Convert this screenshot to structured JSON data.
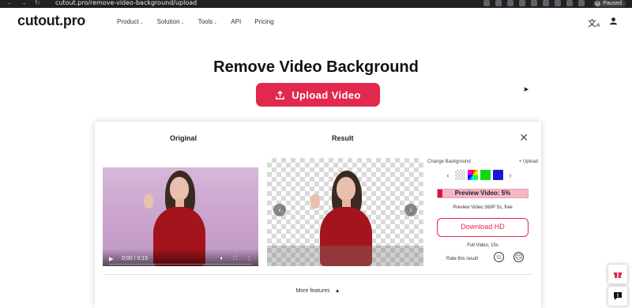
{
  "browser": {
    "url": "cutout.pro/remove-video-background/upload",
    "profile_initial": "F",
    "profile_status": "Paused"
  },
  "header": {
    "logo": "cutout.pro",
    "menu": [
      {
        "label": "Product",
        "has_caret": true
      },
      {
        "label": "Solution",
        "has_caret": true
      },
      {
        "label": "Tools",
        "has_caret": true
      },
      {
        "label": "API",
        "has_caret": false
      },
      {
        "label": "Pricing",
        "has_caret": false
      }
    ]
  },
  "hero": {
    "title": "Remove Video Background",
    "upload_label": "Upload Video"
  },
  "panel": {
    "original_title": "Original",
    "result_title": "Result",
    "video_time": "0:00 / 0:15",
    "change_background": "Change Background",
    "upload_link": "+ Upload",
    "swatches": [
      {
        "name": "transparent",
        "color": "transparent"
      },
      {
        "name": "rainbow",
        "color": "rainbow"
      },
      {
        "name": "green",
        "color": "#11d911"
      },
      {
        "name": "blue",
        "color": "#1a1ad6"
      }
    ],
    "preview_label": "Preview Video: 5%",
    "preview_progress": 0.05,
    "preview_sub": "Preview Video 360P 5s, free",
    "download_label": "Download HD",
    "full_sub": "Full Video, 15s",
    "rate_label": "Rate this result",
    "more_features": "More features"
  },
  "colors": {
    "brand": "#e2284d",
    "progress_fill": "#d6163e",
    "progress_bg": "#f7b6c6"
  },
  "icons": {
    "upload": "upload-icon",
    "close": "close-icon",
    "translate": "translate-icon",
    "user": "user-icon",
    "gift": "gift-icon",
    "feedback": "feedback-icon"
  }
}
